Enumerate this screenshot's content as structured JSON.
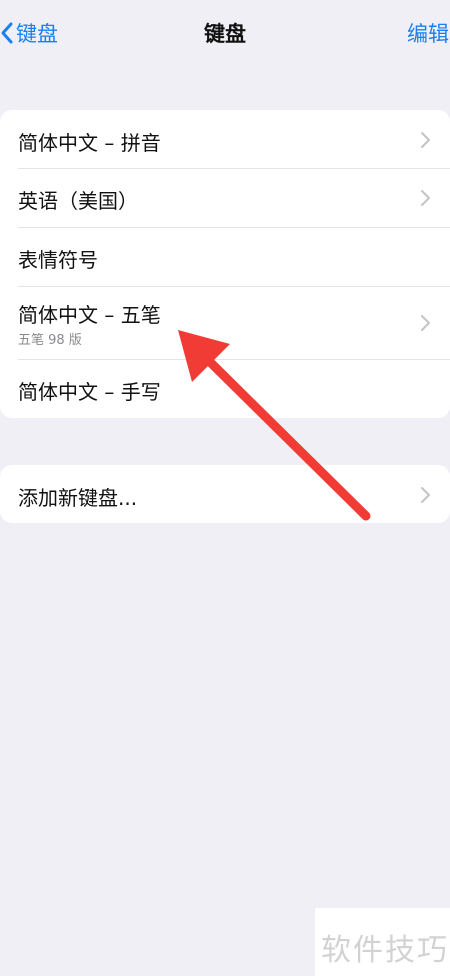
{
  "nav": {
    "back_label": "键盘",
    "title": "键盘",
    "edit_label": "编辑"
  },
  "keyboards": [
    {
      "label": "简体中文 – 拼音",
      "has_chevron": true
    },
    {
      "label": "英语（美国）",
      "has_chevron": true
    },
    {
      "label": "表情符号",
      "has_chevron": false
    },
    {
      "label": "简体中文 – 五笔",
      "sublabel": "五笔 98 版",
      "has_chevron": true
    },
    {
      "label": "简体中文 – 手写",
      "has_chevron": false
    }
  ],
  "add_keyboard": {
    "label": "添加新键盘..."
  },
  "watermark": {
    "text": "软件技巧"
  },
  "colors": {
    "accent": "#1a7ff0",
    "background": "#f0eff5",
    "annotation_arrow": "#f03c34"
  }
}
